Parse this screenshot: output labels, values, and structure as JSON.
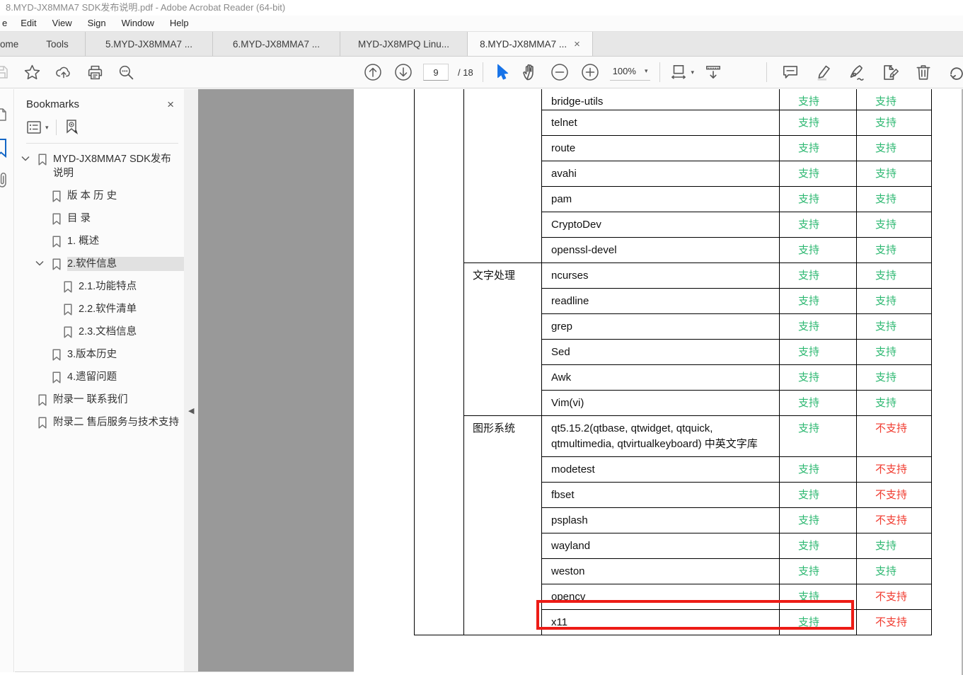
{
  "window": {
    "title": "8.MYD-JX8MMA7 SDK发布说明.pdf - Adobe Acrobat Reader (64-bit)"
  },
  "menu": {
    "items": [
      "e",
      "Edit",
      "View",
      "Sign",
      "Window",
      "Help"
    ]
  },
  "tabs": [
    {
      "label": "ome"
    },
    {
      "label": "Tools"
    },
    {
      "label": "5.MYD-JX8MMA7 ..."
    },
    {
      "label": "6.MYD-JX8MMA7 ..."
    },
    {
      "label": "MYD-JX8MPQ Linu..."
    },
    {
      "label": "8.MYD-JX8MMA7 ...",
      "close": "×",
      "active": true
    }
  ],
  "toolbar": {
    "page_number": "9",
    "page_total_label": "/ 18",
    "zoom_level": "100%"
  },
  "icons": {
    "tab_close": "×",
    "panel_close": "×",
    "collapse_arrow": "◀",
    "dropdown_caret": "▾"
  },
  "bookmarks_panel": {
    "title": "Bookmarks",
    "close": "×",
    "items": [
      {
        "label": "MYD-JX8MMA7 SDK发布说明",
        "level": 0,
        "toggle": true
      },
      {
        "label": "版 本 历 史",
        "level": 1
      },
      {
        "label": "目 录",
        "level": 1
      },
      {
        "label": "1. 概述",
        "level": 1
      },
      {
        "label": "2.软件信息",
        "level": 1,
        "toggle": true,
        "selected": true
      },
      {
        "label": "2.1.功能特点",
        "level": 2
      },
      {
        "label": "2.2.软件清单",
        "level": 2
      },
      {
        "label": "2.3.文档信息",
        "level": 2
      },
      {
        "label": "3.版本历史",
        "level": 1
      },
      {
        "label": "4.遗留问题",
        "level": 1
      },
      {
        "label": "附录一 联系我们",
        "level": 0
      },
      {
        "label": "附录二 售后服务与技术支持",
        "level": 0
      }
    ]
  },
  "document": {
    "support_colors": {
      "yes": "#2eb872",
      "no": "#f03a2e"
    },
    "highlight": {
      "row": "opencv",
      "color": "#ed1c16"
    },
    "table": {
      "groups": [
        {
          "category": "",
          "rows": [
            [
              "bridge-utils",
              "支持",
              "支持"
            ],
            [
              "telnet",
              "支持",
              "支持"
            ],
            [
              "route",
              "支持",
              "支持"
            ],
            [
              "avahi",
              "支持",
              "支持"
            ],
            [
              "pam",
              "支持",
              "支持"
            ],
            [
              "CryptoDev",
              "支持",
              "支持"
            ],
            [
              "openssl-devel",
              "支持",
              "支持"
            ]
          ]
        },
        {
          "category": "文字处理",
          "rows": [
            [
              "ncurses",
              "支持",
              "支持"
            ],
            [
              "readline",
              "支持",
              "支持"
            ],
            [
              "grep",
              "支持",
              "支持"
            ],
            [
              "Sed",
              "支持",
              "支持"
            ],
            [
              "Awk",
              "支持",
              "支持"
            ],
            [
              "Vim(vi)",
              "支持",
              "支持"
            ]
          ]
        },
        {
          "category": "图形系统",
          "rows": [
            [
              "qt5.15.2(qtbase, qtwidget, qtquick, qtmultimedia, qtvirtualkeyboard) 中英文字库",
              "支持",
              "不支持"
            ],
            [
              "modetest",
              "支持",
              "不支持"
            ],
            [
              "fbset",
              "支持",
              "不支持"
            ],
            [
              "psplash",
              "支持",
              "不支持"
            ],
            [
              "wayland",
              "支持",
              "支持"
            ],
            [
              "weston",
              "支持",
              "支持"
            ],
            [
              "opencv",
              "支持",
              "不支持"
            ],
            [
              "x11",
              "支持",
              "不支持"
            ]
          ]
        }
      ]
    }
  }
}
